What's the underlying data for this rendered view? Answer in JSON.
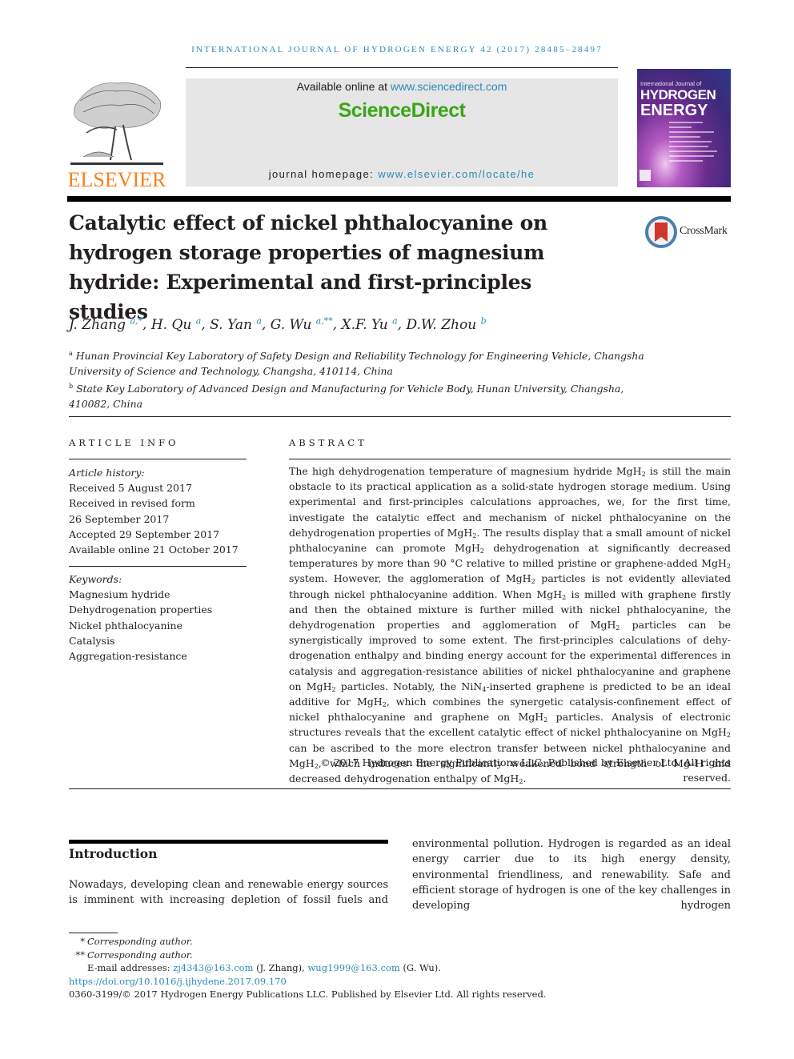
{
  "running_header": "International Journal of Hydrogen Energy 42 (2017) 28485–28497",
  "masthead": {
    "publisher_logo_label": "ELSEVIER",
    "available_prefix": "Available online at ",
    "available_link": "www.sciencedirect.com",
    "brand": "ScienceDirect",
    "homepage_prefix": "journal homepage: ",
    "homepage_link": "www.elsevier.com/locate/he",
    "cover": {
      "line1": "International Journal of",
      "line2": "HYDROGEN",
      "line3": "ENERGY"
    },
    "colors": {
      "link": "#2a8ab8",
      "brand_green": "#3aa616",
      "elsevier_orange": "#f58220"
    }
  },
  "article": {
    "title": "Catalytic effect of nickel phthalocyanine on hydrogen storage properties of magnesium hydride: Experimental and first-principles studies",
    "crossmark_label": "CrossMark",
    "authors": [
      {
        "name": "J. Zhang",
        "sup": "a,*"
      },
      {
        "name": "H. Qu",
        "sup": "a"
      },
      {
        "name": "S. Yan",
        "sup": "a"
      },
      {
        "name": "G. Wu",
        "sup": "a,**"
      },
      {
        "name": "X.F. Yu",
        "sup": "a"
      },
      {
        "name": "D.W. Zhou",
        "sup": "b"
      }
    ],
    "affiliations": [
      {
        "mark": "a",
        "text": "Hunan Provincial Key Laboratory of Safety Design and Reliability Technology for Engineering Vehicle, Changsha University of Science and Technology, Changsha, 410114, China"
      },
      {
        "mark": "b",
        "text": "State Key Laboratory of Advanced Design and Manufacturing for Vehicle Body, Hunan University, Changsha, 410082, China"
      }
    ]
  },
  "article_info": {
    "heading": "ARTICLE INFO",
    "history_label": "Article history:",
    "history": [
      "Received 5 August 2017",
      "Received in revised form",
      "26 September 2017",
      "Accepted 29 September 2017",
      "Available online 21 October 2017"
    ],
    "keywords_label": "Keywords:",
    "keywords": [
      "Magnesium hydride",
      "Dehydrogenation properties",
      "Nickel phthalocyanine",
      "Catalysis",
      "Aggregation-resistance"
    ]
  },
  "abstract": {
    "heading": "ABSTRACT",
    "segments": [
      "The high dehydrogenation temperature of magnesium hydride MgH",
      "2",
      " is still the main obstacle to its practical application as a solid-state hydrogen storage medium. Using experimental and first-principles calculations approaches, we, for the first time, investigate the catalytic effect and mechanism of nickel phthalocyanine on the dehydrogenation properties of MgH",
      "2",
      ". The results display that a small amount of nickel phthalocyanine can promote MgH",
      "2",
      " dehydrogenation at significantly decreased temperatures by more than 90 °C relative to milled pristine or graphene-added MgH",
      "2",
      " system. However, the agglomeration of MgH",
      "2",
      " particles is not evidently alleviated through nickel phthalocyanine addition. When MgH",
      "2",
      " is milled with graphene firstly and then the obtained mixture is further milled with nickel phthalocyanine, the dehydrogenation properties and agglomeration of MgH",
      "2",
      " particles can be synergistically improved to some extent. The first-principles calculations of dehy­drogenation enthalpy and binding energy account for the experimental differences in catalysis and aggregation-resistance abilities of nickel phthalocyanine and graphene on MgH",
      "2",
      " particles. Notably, the NiN",
      "4",
      "-inserted graphene is predicted to be an ideal additive for MgH",
      "2",
      ", which combines the synergetic catalysis-confinement effect of nickel phthalocyanine and graphene on MgH",
      "2",
      " particles. Analysis of electronic structures reveals that the excellent catalytic effect of nickel phthalocyanine on MgH",
      "2",
      " can be ascribed to the more electron transfer between nickel phthalocyanine and MgH",
      "2",
      ", which induces the significantly weak­ened bond strength of Mg–H and decreased dehydrogenation enthalpy of MgH",
      "2",
      "."
    ],
    "copyright": "© 2017 Hydrogen Energy Publications LLC. Published by Elsevier Ltd. All rights reserved."
  },
  "body": {
    "section_heading": "Introduction",
    "left_column": "Nowadays, developing clean and renewable energy sources is imminent with increasing depletion of fossil fuels and",
    "right_column": "environmental pollution. Hydrogen is regarded as an ideal energy carrier due to its high energy density, environmental friendliness, and renewability. Safe and efficient storage of hydrogen is one of the key challenges in developing hydrogen"
  },
  "footnotes": {
    "corr1_mark": "*",
    "corr1_text": "Corresponding author.",
    "corr2_mark": "**",
    "corr2_text": "Corresponding author.",
    "email_label": "E-mail addresses: ",
    "email1": "zj4343@163.com",
    "email1_owner": " (J. Zhang), ",
    "email2": "wug1999@163.com",
    "email2_owner": " (G. Wu).",
    "doi": "https://doi.org/10.1016/j.ijhydene.2017.09.170",
    "issn_copyright": "0360-3199/© 2017 Hydrogen Energy Publications LLC. Published by Elsevier Ltd. All rights reserved."
  }
}
